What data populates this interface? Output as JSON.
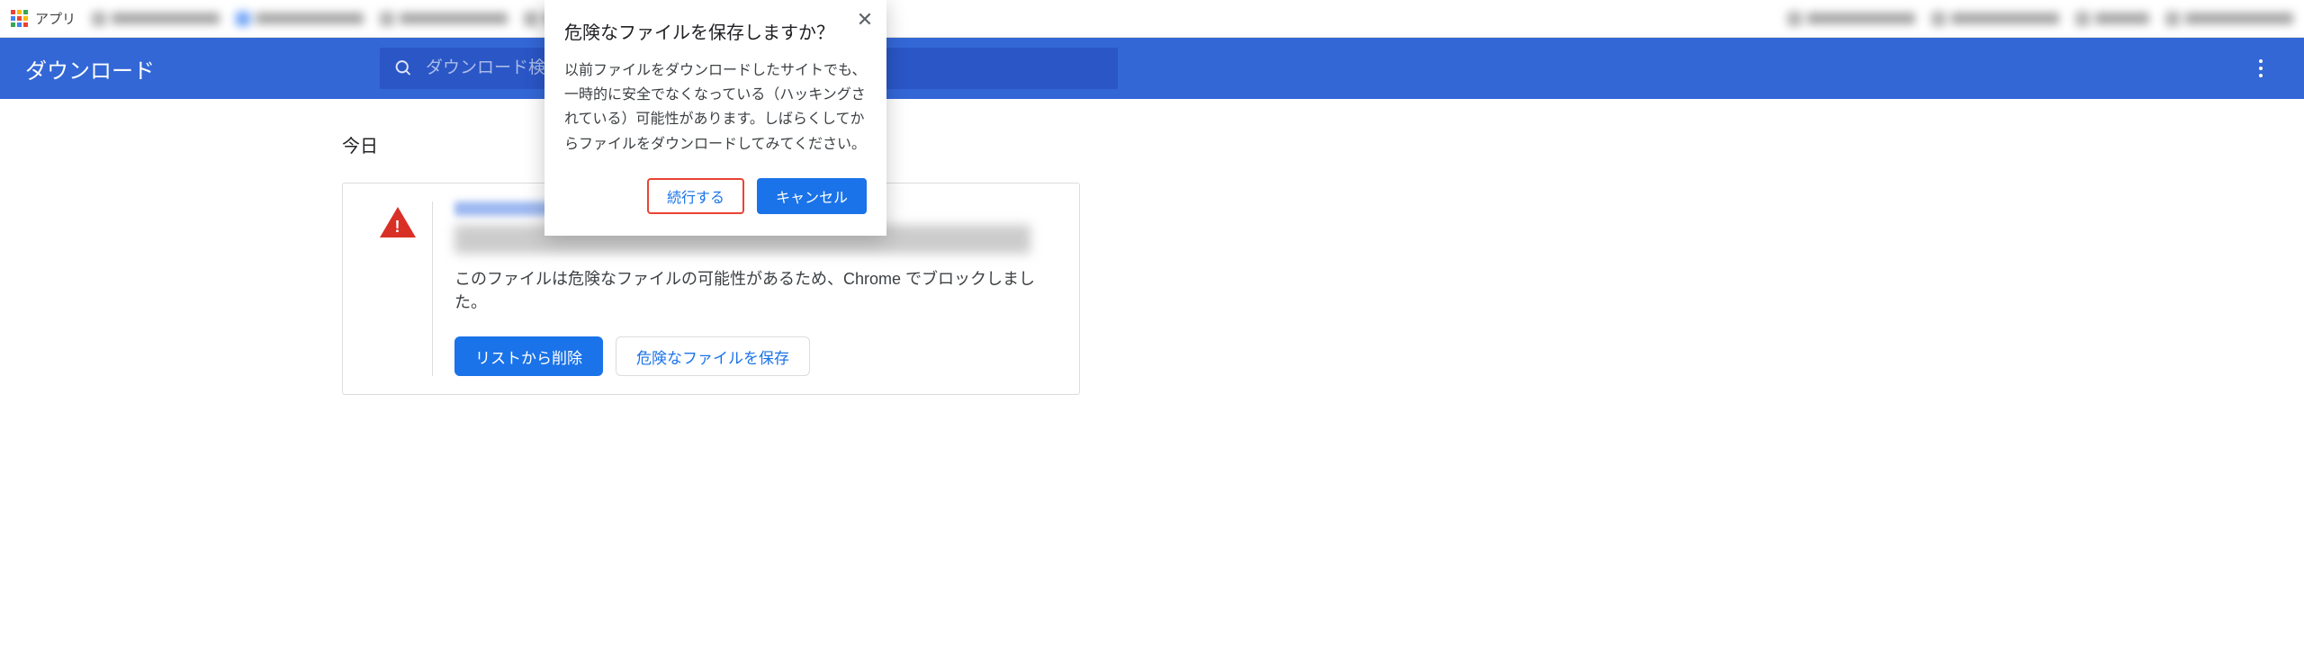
{
  "bookmarks": {
    "apps_label": "アプリ"
  },
  "header": {
    "title": "ダウンロード",
    "search_placeholder": "ダウンロード検索"
  },
  "section": {
    "today_label": "今日"
  },
  "download_item": {
    "message": "このファイルは危険なファイルの可能性があるため、Chrome でブロックしました。",
    "remove_label": "リストから削除",
    "keep_label": "危険なファイルを保存"
  },
  "dialog": {
    "title": "危険なファイルを保存しますか？",
    "body": "以前ファイルをダウンロードしたサイトでも、一時的に安全でなくなっている（ハッキングされている）可能性があります。しばらくしてからファイルをダウンロードしてみてください。",
    "continue_label": "続行する",
    "cancel_label": "キャンセル"
  }
}
